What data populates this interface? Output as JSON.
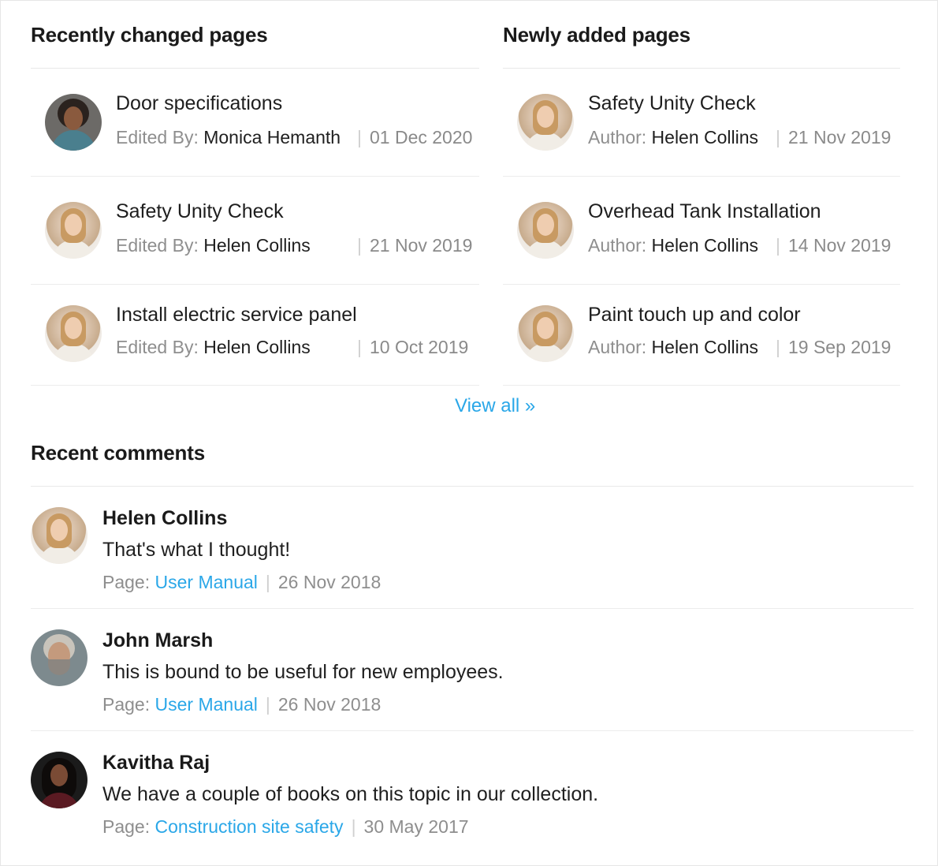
{
  "recently_changed": {
    "title": "Recently changed pages",
    "items": [
      {
        "title": "Door  specifications",
        "label": "Edited By:",
        "person": "Monica Hemanth",
        "date": "01 Dec 2020",
        "avatar": "monica-avatar"
      },
      {
        "title": "Safety Unity Check",
        "label": "Edited By:",
        "person": "Helen Collins",
        "date": "21 Nov 2019",
        "avatar": "helen-avatar"
      },
      {
        "title": "Install electric service panel",
        "label": "Edited By:",
        "person": "Helen Collins",
        "date": "10 Oct 2019",
        "avatar": "helen-avatar"
      }
    ]
  },
  "newly_added": {
    "title": "Newly added pages",
    "items": [
      {
        "title": "Safety Unity Check",
        "label": "Author:",
        "person": "Helen Collins",
        "date": "21 Nov 2019",
        "avatar": "helen-avatar"
      },
      {
        "title": "Overhead Tank Installation",
        "label": "Author:",
        "person": "Helen Collins",
        "date": "14 Nov 2019",
        "avatar": "helen-avatar"
      },
      {
        "title": "Paint touch up and color",
        "label": "Author:",
        "person": "Helen Collins",
        "date": "19 Sep 2019",
        "avatar": "helen-avatar"
      }
    ]
  },
  "view_all": "View all »",
  "comments": {
    "title": "Recent comments",
    "items": [
      {
        "author": "Helen Collins",
        "text": "That's what I thought!",
        "page_label": "Page:",
        "page": "User Manual",
        "date": "26 Nov 2018",
        "avatar": "helen-avatar"
      },
      {
        "author": "John Marsh",
        "text": "This is bound to be useful for new employees.",
        "page_label": "Page:",
        "page": "User Manual",
        "date": "26 Nov 2018",
        "avatar": "john-avatar"
      },
      {
        "author": "Kavitha Raj",
        "text": "We have a couple of books on this topic in our collection.",
        "page_label": "Page:",
        "page": "Construction site safety",
        "date": "30 May 2017",
        "avatar": "kavitha-avatar"
      }
    ]
  },
  "colors": {
    "link": "#2aa7e8",
    "muted": "#8e8e8e",
    "divider": "#ececec"
  }
}
